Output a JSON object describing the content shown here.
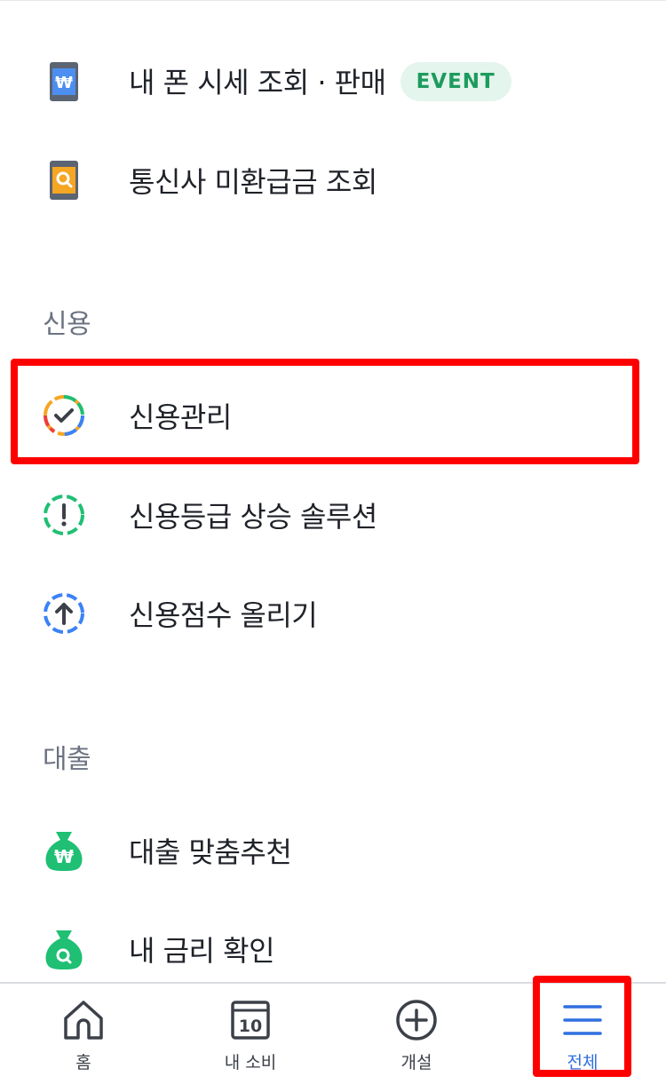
{
  "items": {
    "phone_price": {
      "label": "내 폰 시세 조회 · 판매",
      "badge": "EVENT",
      "icon": "phone-won-icon"
    },
    "telecom_refund": {
      "label": "통신사 미환급금 조회",
      "icon": "phone-search-icon"
    },
    "credit_manage": {
      "label": "신용관리",
      "icon": "credit-check-icon"
    },
    "credit_grade_up": {
      "label": "신용등급 상승 솔루션",
      "icon": "credit-alert-icon"
    },
    "credit_score_up": {
      "label": "신용점수 올리기",
      "icon": "credit-arrow-up-icon"
    },
    "loan_recommend": {
      "label": "대출 맞춤추천",
      "icon": "moneybag-won-icon"
    },
    "my_rate": {
      "label": "내 금리 확인",
      "icon": "moneybag-search-icon"
    }
  },
  "sections": {
    "credit": "신용",
    "loan": "대출"
  },
  "tabbar": {
    "home": {
      "label": "홈",
      "icon": "home-icon"
    },
    "spending": {
      "label": "내 소비",
      "icon": "calendar-10-icon",
      "icon_text": "10"
    },
    "open": {
      "label": "개설",
      "icon": "plus-circle-icon"
    },
    "all": {
      "label": "전체",
      "icon": "menu-icon",
      "active": true
    }
  },
  "colors": {
    "accent": "#2f6fe0",
    "highlight": "#ff0000",
    "badge_bg": "#e3f5ec",
    "badge_text": "#1d9b5e",
    "green": "#1fbf74"
  }
}
